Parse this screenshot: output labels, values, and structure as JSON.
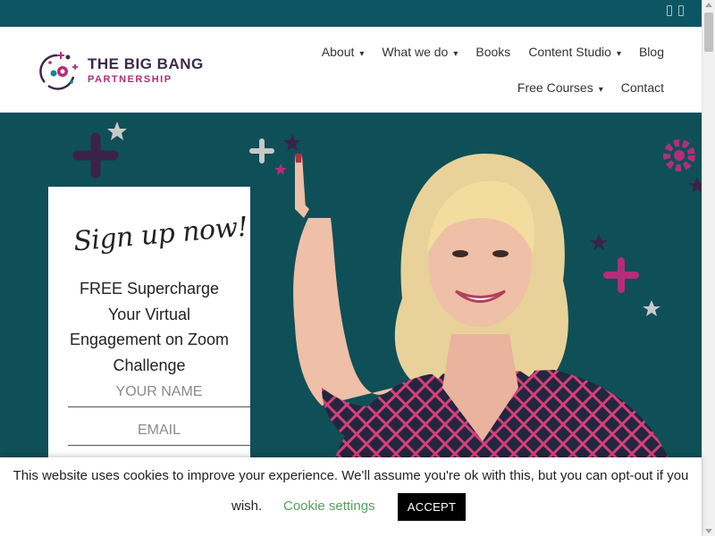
{
  "brand": {
    "title": "THE BIG BANG",
    "subtitle": "PARTNERSHIP",
    "colors": {
      "primary": "#3a2a4a",
      "accent": "#b32d7a",
      "teal": "#0d5563"
    }
  },
  "nav": {
    "row1": [
      {
        "label": "About",
        "caret": "▾"
      },
      {
        "label": "What we do",
        "caret": "▾"
      },
      {
        "label": "Books",
        "caret": ""
      },
      {
        "label": "Content Studio",
        "caret": "▾"
      },
      {
        "label": "Blog",
        "caret": ""
      }
    ],
    "row2": [
      {
        "label": "Free Courses",
        "caret": "▾"
      },
      {
        "label": "Contact",
        "caret": ""
      }
    ]
  },
  "signup": {
    "script_title": "Sign up now!",
    "description": "FREE Supercharge Your Virtual Engagement on Zoom Challenge",
    "name_placeholder": "YOUR NAME",
    "email_placeholder": "EMAIL"
  },
  "cookie": {
    "message": "This website uses cookies to improve your experience. We'll assume you're ok with this, but you can opt-out if you",
    "message_end": "wish.",
    "settings_label": "Cookie settings",
    "accept_label": "ACCEPT"
  }
}
